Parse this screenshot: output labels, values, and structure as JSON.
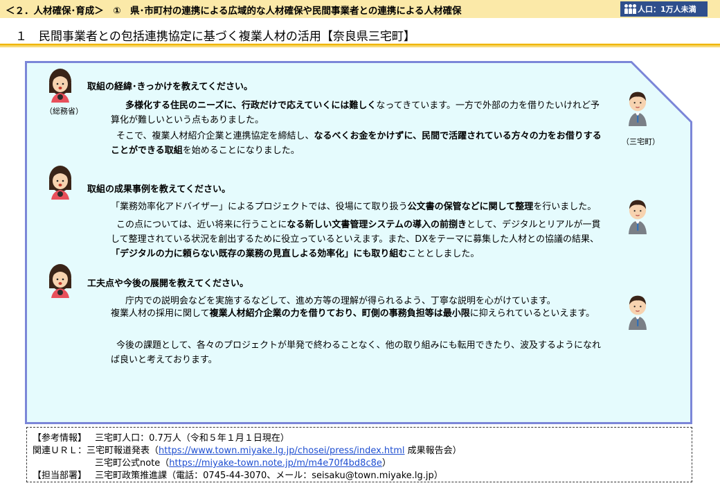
{
  "header": {
    "title": "＜２．人材確保･育成＞　①　県･市町村の連携による広域的な人材確保や民間事業者との連携による人材確保",
    "population_badge": "人口：1万人未満"
  },
  "page_heading": "１　民間事業者との包括連携協定に基づく複業人材の活用【奈良県三宅町】",
  "speakers": {
    "left": "（総務省）",
    "right": "（三宅町）"
  },
  "sections": [
    {
      "question": "取組の経緯･きっかけを教えてください。",
      "paragraphs": [
        [
          {
            "t": "　",
            "b": false
          },
          {
            "t": "多様化する住民のニーズに、行政だけで応えていくには難しく",
            "b": true
          },
          {
            "t": "なってきています。一方で外部の力を借りたいけれど予算化が難しいという点もありました。",
            "b": false
          }
        ],
        [
          {
            "t": "そこで、複業人材紹介企業と連携協定を締結し、",
            "b": false
          },
          {
            "t": "なるべくお金をかけずに、民間で活躍されている方々の力をお借りすることができる取組",
            "b": true
          },
          {
            "t": "を始めることになりました。",
            "b": false
          }
        ]
      ]
    },
    {
      "question": "取組の成果事例を教えてください。",
      "paragraphs": [
        [
          {
            "t": "「業務効率化アドバイザー」によるプロジェクトでは、役場にて取り扱う",
            "b": false
          },
          {
            "t": "公文書の保管などに関して整理",
            "b": true
          },
          {
            "t": "を行いました。",
            "b": false
          }
        ],
        [
          {
            "t": "この点については、近い将来に行うことに",
            "b": false
          },
          {
            "t": "なる新しい文書管理システムの導入の前捌き",
            "b": true
          },
          {
            "t": "として、デジタルとリアルが一貫して整理されている状況を創出するために役立っているといえます。また、DXをテーマに募集した人材との協議の結果、",
            "b": false
          },
          {
            "t": "「デジタルの力に頼らない既存の業務の見直しよる効率化」にも取り組む",
            "b": true
          },
          {
            "t": "こととしました。",
            "b": false
          }
        ]
      ]
    },
    {
      "question": "工夫点や今後の展開を教えてください。",
      "paragraphs": [
        [
          {
            "t": "　",
            "b": false
          },
          {
            "t": "庁内での説明会などを実施するなどして、進め方等の理解が得られるよう、丁寧な説明を心がけています。",
            "b": false
          }
        ],
        [
          {
            "t": "複業人材の採用に関して",
            "b": false
          },
          {
            "t": "複業人材紹介企業の力を借りており、町側の事務負担等は最小限",
            "b": true
          },
          {
            "t": "に抑えられているといえます。",
            "b": false
          }
        ],
        [
          {
            "t": "今後の課題として、各々のプロジェクトが単発で終わることなく、他の取り組みにも転用できたり、波及するようになれば良いと考えております。",
            "b": false
          }
        ]
      ]
    }
  ],
  "info": {
    "ref_label": "【参考情報】",
    "ref_text": "三宅町人口：0.7万人（令和５年１月１日現在）",
    "url_label": "関連ＵＲＬ：",
    "press_prefix": "三宅町報道発表（",
    "press_url": "https://www.town.miyake.lg.jp/chosei/press/index.html",
    "press_suffix": " 成果報告会）",
    "note_prefix": "三宅町公式note（",
    "note_url": "https://miyake-town.note.jp/m/m4e70f4bd8c8e",
    "note_suffix": "）",
    "dept_label": "【担当部署】",
    "dept_text": "三宅町政策推進課（電話：0745-44-3070、メール：seisaku@town.miyake.lg.jp）"
  },
  "colors": {
    "header_bg": "#fbe9a8",
    "badge_bg": "#2f4f8c",
    "accent_rule": "#f0b800",
    "panel_fill": "#e5fbfd",
    "panel_border": "#7b86d8",
    "link": "#1f4fd1"
  }
}
